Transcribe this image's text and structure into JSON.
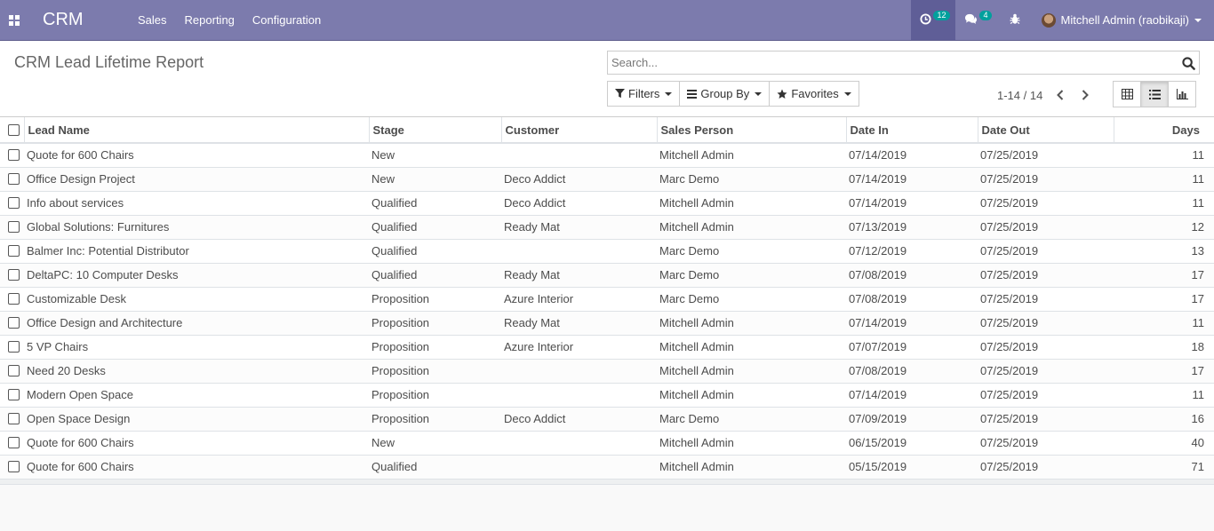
{
  "app": {
    "brand": "CRM"
  },
  "menu": [
    {
      "label": "Sales"
    },
    {
      "label": "Reporting"
    },
    {
      "label": "Configuration"
    }
  ],
  "systray": {
    "activities_count": "12",
    "messages_count": "4",
    "user_name": "Mitchell Admin (raobikaji)"
  },
  "page": {
    "title": "CRM Lead Lifetime Report"
  },
  "search": {
    "placeholder": "Search..."
  },
  "controls": {
    "filters_label": "Filters",
    "groupby_label": "Group By",
    "favorites_label": "Favorites"
  },
  "pager": {
    "value": "1-14 / 14"
  },
  "table": {
    "columns": [
      "Lead Name",
      "Stage",
      "Customer",
      "Sales Person",
      "Date In",
      "Date Out",
      "Days"
    ],
    "rows": [
      [
        "Quote for 600 Chairs",
        "New",
        "",
        "Mitchell Admin",
        "07/14/2019",
        "07/25/2019",
        "11"
      ],
      [
        "Office Design Project",
        "New",
        "Deco Addict",
        "Marc Demo",
        "07/14/2019",
        "07/25/2019",
        "11"
      ],
      [
        "Info about services",
        "Qualified",
        "Deco Addict",
        "Mitchell Admin",
        "07/14/2019",
        "07/25/2019",
        "11"
      ],
      [
        "Global Solutions: Furnitures",
        "Qualified",
        "Ready Mat",
        "Mitchell Admin",
        "07/13/2019",
        "07/25/2019",
        "12"
      ],
      [
        "Balmer Inc: Potential Distributor",
        "Qualified",
        "",
        "Marc Demo",
        "07/12/2019",
        "07/25/2019",
        "13"
      ],
      [
        "DeltaPC: 10 Computer Desks",
        "Qualified",
        "Ready Mat",
        "Marc Demo",
        "07/08/2019",
        "07/25/2019",
        "17"
      ],
      [
        "Customizable Desk",
        "Proposition",
        "Azure Interior",
        "Marc Demo",
        "07/08/2019",
        "07/25/2019",
        "17"
      ],
      [
        "Office Design and Architecture",
        "Proposition",
        "Ready Mat",
        "Mitchell Admin",
        "07/14/2019",
        "07/25/2019",
        "11"
      ],
      [
        "5 VP Chairs",
        "Proposition",
        "Azure Interior",
        "Mitchell Admin",
        "07/07/2019",
        "07/25/2019",
        "18"
      ],
      [
        "Need 20 Desks",
        "Proposition",
        "",
        "Mitchell Admin",
        "07/08/2019",
        "07/25/2019",
        "17"
      ],
      [
        "Modern Open Space",
        "Proposition",
        "",
        "Mitchell Admin",
        "07/14/2019",
        "07/25/2019",
        "11"
      ],
      [
        "Open Space Design",
        "Proposition",
        "Deco Addict",
        "Marc Demo",
        "07/09/2019",
        "07/25/2019",
        "16"
      ],
      [
        "Quote for 600 Chairs",
        "New",
        "",
        "Mitchell Admin",
        "06/15/2019",
        "07/25/2019",
        "40"
      ],
      [
        "Quote for 600 Chairs",
        "Qualified",
        "",
        "Mitchell Admin",
        "05/15/2019",
        "07/25/2019",
        "71"
      ]
    ]
  },
  "colors": {
    "navbar": "#7c7bad",
    "navbar_active": "#5f5e97",
    "badge": "#00a09d"
  }
}
